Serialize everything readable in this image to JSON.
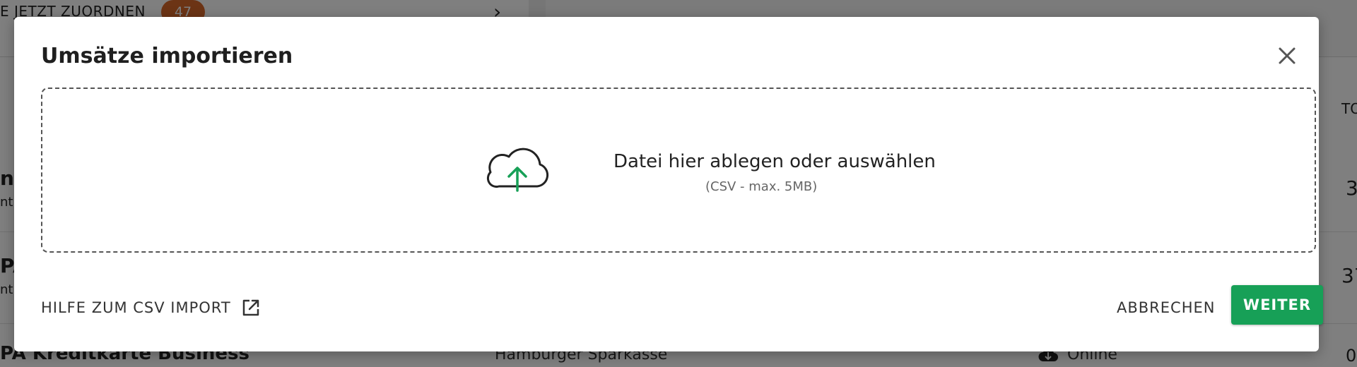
{
  "background": {
    "assign_label": "E JETZT ZUORDNEN",
    "assign_count": "47",
    "rows": [
      {
        "left_frag": "n",
        "left_sub": "nt",
        "right_frag": "3"
      },
      {
        "left_frag": "PA",
        "left_sub": "nt",
        "right_frag": "37"
      }
    ],
    "header_right_frag": "TO",
    "bottom_row": {
      "account": "PA Kreditkarte Business",
      "bank": "Hamburger Sparkasse",
      "status": "Online",
      "value_frag": "0"
    }
  },
  "modal": {
    "title": "Umsätze importieren",
    "dropzone": {
      "text": "Datei hier ablegen oder auswählen",
      "hint": "(CSV - max. 5MB)",
      "icon": "cloud-upload-icon",
      "accent": "#17a057"
    },
    "footer": {
      "help_label": "HILFE ZUM CSV IMPORT",
      "cancel_label": "ABBRECHEN",
      "next_label": "WEITER"
    }
  },
  "colors": {
    "primary": "#17a057",
    "badge": "#d9682b"
  }
}
